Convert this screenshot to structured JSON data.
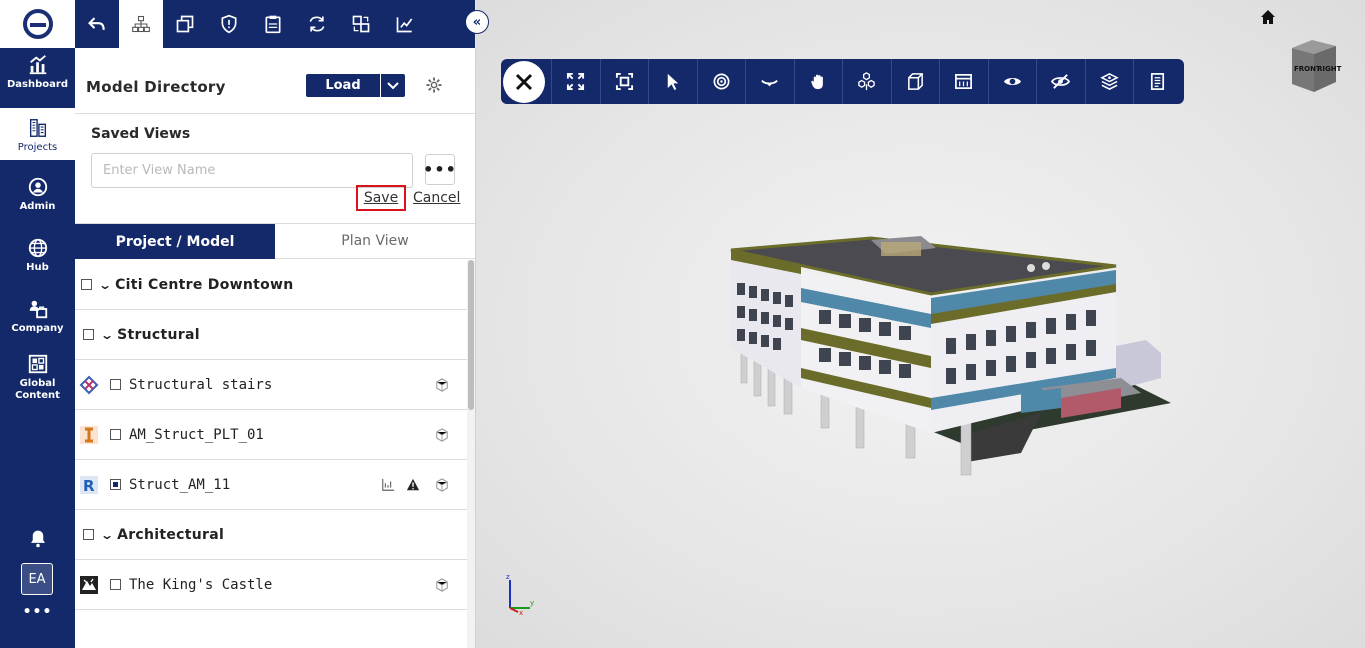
{
  "rail": {
    "items": [
      {
        "label": "Dashboard",
        "icon": "chart-icon"
      },
      {
        "label": "Projects",
        "icon": "buildings-icon"
      },
      {
        "label": "Admin",
        "icon": "user-circle-icon"
      },
      {
        "label": "Hub",
        "icon": "globe-icon"
      },
      {
        "label": "Company",
        "icon": "company-icon"
      },
      {
        "label": "Global Content",
        "icon": "grid-icon"
      }
    ],
    "avatar": "EA",
    "more": "•••"
  },
  "panel": {
    "title": "Model Directory",
    "load_label": "Load",
    "saved_views": {
      "title": "Saved Views",
      "placeholder": "Enter View Name",
      "more": "•••",
      "save": "Save",
      "cancel": "Cancel"
    },
    "tabs": [
      {
        "label": "Project / Model",
        "active": true
      },
      {
        "label": "Plan View",
        "active": false
      }
    ],
    "tree": {
      "project": "Citi Centre Downtown",
      "structural": "Structural",
      "items": [
        {
          "label": "Structural stairs"
        },
        {
          "label": "AM_Struct_PLT_01"
        },
        {
          "label": "Struct_AM_11"
        }
      ],
      "architectural": "Architectural",
      "arch_items": [
        {
          "label": "The King's Castle"
        }
      ]
    }
  },
  "viewer": {
    "navcube_front": "FRONT",
    "navcube_right": "RIGHT",
    "axis_z": "z",
    "axis_x": "x",
    "axis_y": "y"
  },
  "colors": {
    "navy": "#13296a",
    "highlight": "#d6141a"
  }
}
